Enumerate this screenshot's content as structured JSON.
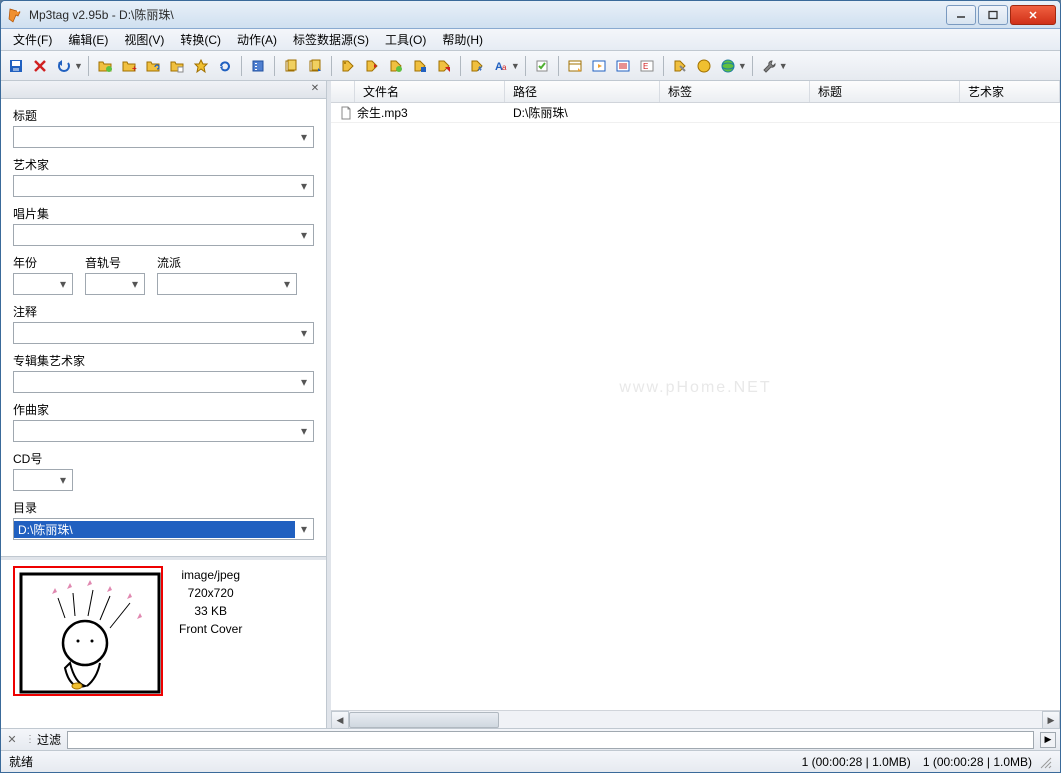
{
  "window": {
    "title": "Mp3tag v2.95b  -  D:\\陈丽珠\\"
  },
  "menu": {
    "file": "文件(F)",
    "edit": "编辑(E)",
    "view": "视图(V)",
    "convert": "转换(C)",
    "action": "动作(A)",
    "tagsource": "标签数据源(S)",
    "tools": "工具(O)",
    "help": "帮助(H)"
  },
  "sidebar": {
    "title_label": "标题",
    "title_value": "",
    "artist_label": "艺术家",
    "artist_value": "",
    "album_label": "唱片集",
    "album_value": "",
    "year_label": "年份",
    "year_value": "",
    "track_label": "音轨号",
    "track_value": "",
    "genre_label": "流派",
    "genre_value": "",
    "comment_label": "注释",
    "comment_value": "",
    "albumartist_label": "专辑集艺术家",
    "albumartist_value": "",
    "composer_label": "作曲家",
    "composer_value": "",
    "discnum_label": "CD号",
    "discnum_value": "",
    "directory_label": "目录",
    "directory_value": "D:\\陈丽珠\\"
  },
  "cover": {
    "mime": "image/jpeg",
    "dimensions": "720x720",
    "size": "33 KB",
    "type": "Front Cover"
  },
  "columns": {
    "filename": "文件名",
    "path": "路径",
    "tag": "标签",
    "title": "标题",
    "artist": "艺术家"
  },
  "rows": [
    {
      "filename": "余生.mp3",
      "path": "D:\\陈丽珠\\",
      "tag": "",
      "title": "",
      "artist": ""
    }
  ],
  "filter": {
    "label": "过滤",
    "value": ""
  },
  "status": {
    "ready": "就绪",
    "total": "1 (00:00:28 | 1.0MB)",
    "selected": "1 (00:00:28 | 1.0MB)"
  },
  "watermark": "www.pHome.NET"
}
